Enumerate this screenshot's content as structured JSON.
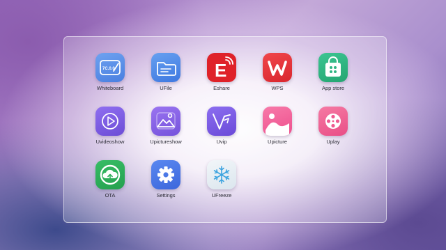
{
  "apps": [
    {
      "label": "Whiteboard",
      "icon": "whiteboard-icon",
      "color": "#5b8ee8",
      "badge": "7C.0.0"
    },
    {
      "label": "UFile",
      "icon": "folder-icon",
      "color": "#4e86e6"
    },
    {
      "label": "Eshare",
      "icon": "eshare-icon",
      "color": "#e0262d",
      "glyph": "E"
    },
    {
      "label": "WPS",
      "icon": "wps-icon",
      "color": "#e9363b",
      "glyph": "W"
    },
    {
      "label": "App store",
      "icon": "shopping-bag-icon",
      "color": "#2fb582"
    },
    {
      "label": "Uvideoshow",
      "icon": "play-icon",
      "color": "#7e5ce0"
    },
    {
      "label": "Upictureshow",
      "icon": "image-gallery-icon",
      "color": "#8a63e6"
    },
    {
      "label": "Uvip",
      "icon": "uvip-icon",
      "color": "#7a5ade"
    },
    {
      "label": "Upicture",
      "icon": "picture-icon",
      "color": "#f2639a"
    },
    {
      "label": "Uplay",
      "icon": "film-reel-icon",
      "color": "#f06292"
    },
    {
      "label": "OTA",
      "icon": "cloud-upload-icon",
      "color": "#2fae5a"
    },
    {
      "label": "Settings",
      "icon": "gear-icon",
      "color": "#4a78e6"
    },
    {
      "label": "UFreeze",
      "icon": "snowflake-icon",
      "color": "#e6eef4"
    }
  ]
}
